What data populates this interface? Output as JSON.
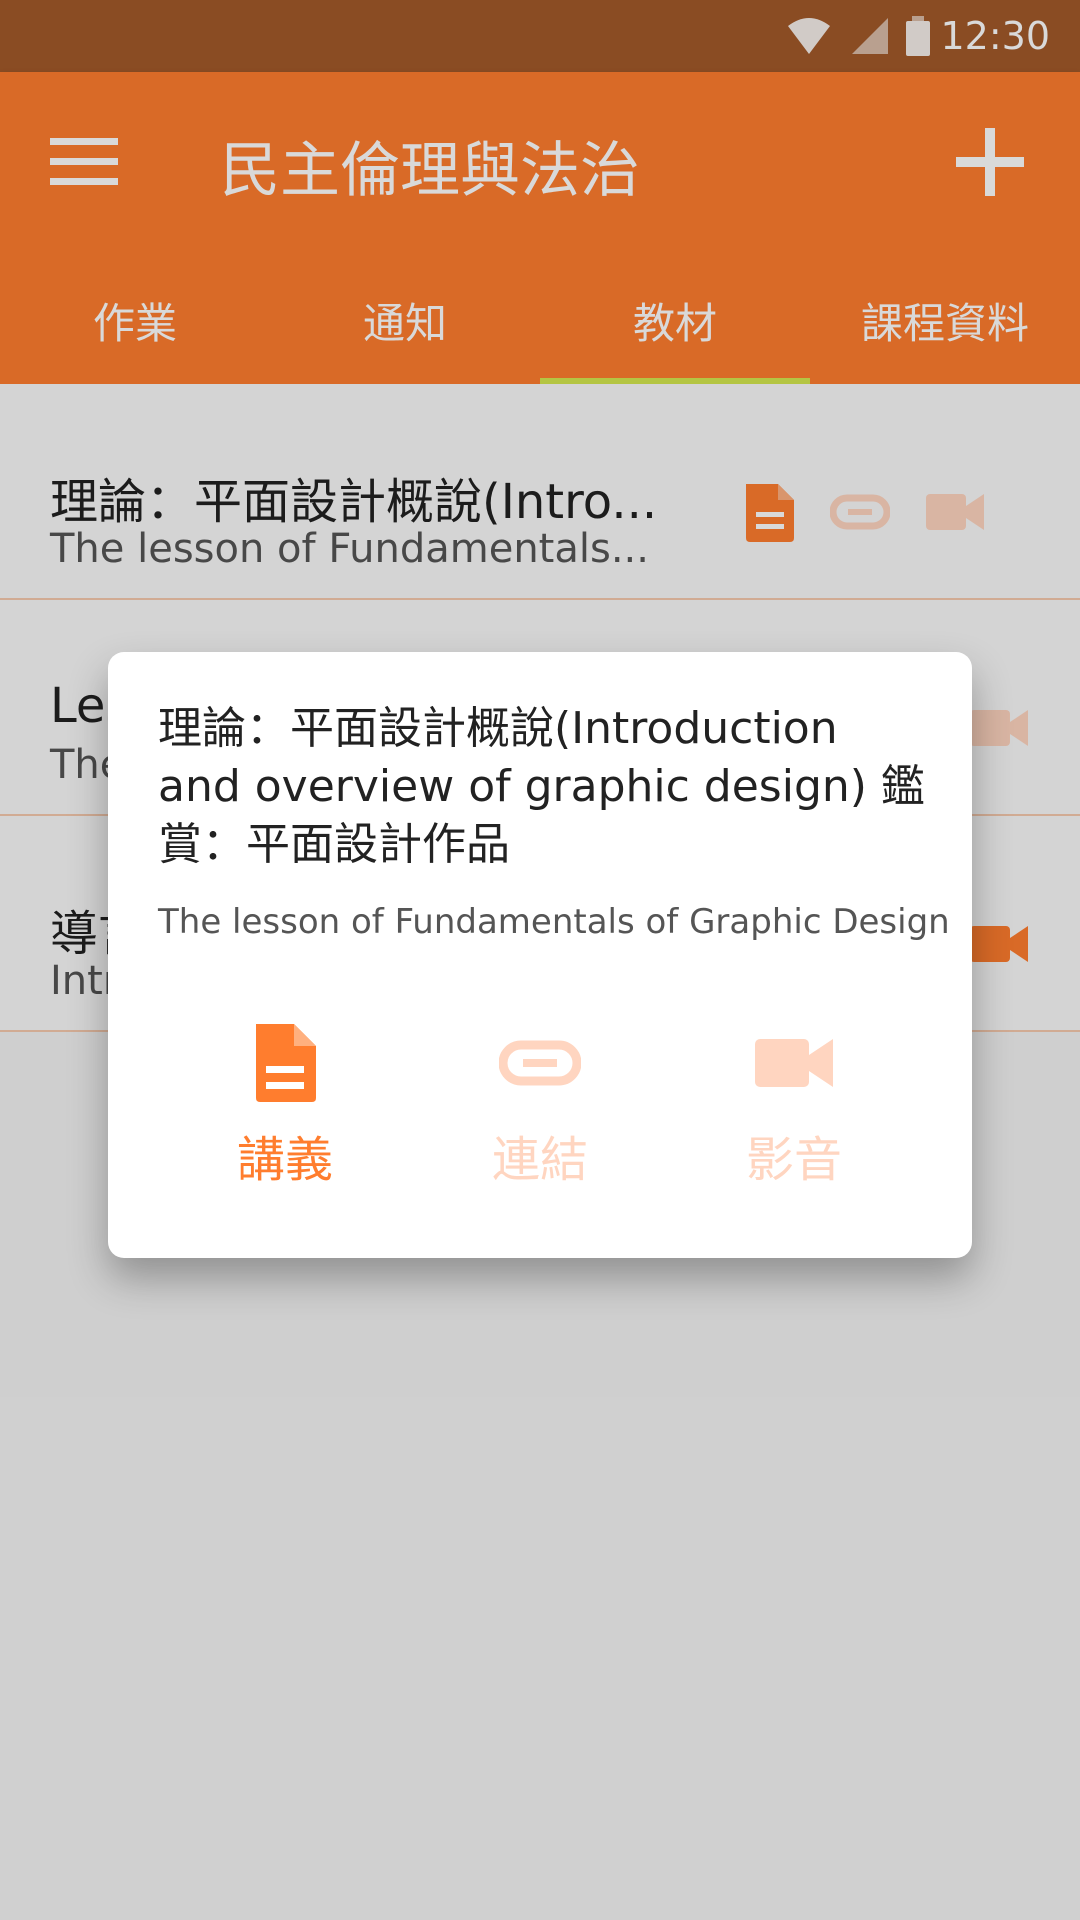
{
  "colors": {
    "accent": "#ff7d2e",
    "status_bar": "#a35a2a",
    "tab_indicator": "#d4e84f",
    "disabled": "#ffd5c0",
    "divider": "#f6c9ad"
  },
  "status_bar": {
    "time": "12:30",
    "icons": [
      "wifi-icon",
      "signal-icon",
      "battery-icon"
    ]
  },
  "app_bar": {
    "title": "民主倫理與法治",
    "menu_icon": "menu-icon",
    "add_icon": "add-icon"
  },
  "tabs": [
    {
      "label": "作業"
    },
    {
      "label": "通知"
    },
    {
      "label": "教材",
      "active": true
    },
    {
      "label": "課程資料"
    }
  ],
  "materials": [
    {
      "title": "理論：平面設計概說(Intro...",
      "subtitle": "The lesson of Fundamentals...",
      "icons": [
        "document-icon",
        "link-icon",
        "video-icon"
      ]
    },
    {
      "title": "Les",
      "subtitle": "The",
      "icons": [
        "video-icon"
      ]
    },
    {
      "title": "導言",
      "subtitle": "Intr",
      "icons": [
        "video-icon"
      ]
    }
  ],
  "dialog": {
    "title": "理論：平面設計概說(Introduction and overview of graphic design) 鑑賞：平面設計作品",
    "subtitle": "The lesson of Fundamentals of Graphic Design",
    "actions": [
      {
        "label": "講義",
        "icon": "document-icon",
        "enabled": true
      },
      {
        "label": "連結",
        "icon": "link-icon",
        "enabled": false
      },
      {
        "label": "影音",
        "icon": "video-icon",
        "enabled": false
      }
    ]
  }
}
